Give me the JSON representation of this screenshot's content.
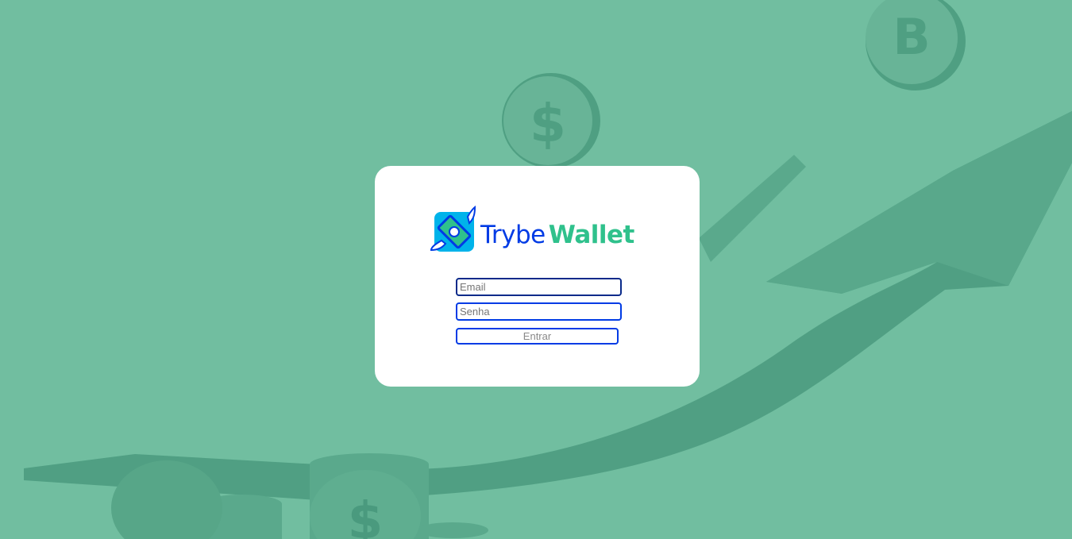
{
  "brand": {
    "name_part1": "Trybe",
    "name_part2": "Wallet",
    "logo_icon": "flying-money-icon",
    "colors": {
      "blue": "#003be5",
      "green": "#2fc18c",
      "background": "#74c0a4"
    }
  },
  "login": {
    "email_placeholder": "Email",
    "email_value": "",
    "password_placeholder": "Senha",
    "password_value": "",
    "submit_label": "Entrar"
  },
  "background": {
    "icons": [
      "bitcoin-coin-icon",
      "dollar-coin-icon",
      "growth-arrow-icon",
      "coin-stack-icon"
    ]
  }
}
